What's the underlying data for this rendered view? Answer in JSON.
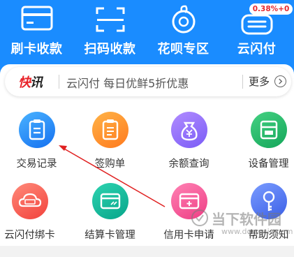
{
  "colors": {
    "header_blue": "#1a8cff",
    "news_tag_red": "#e8232a",
    "annotation_arrow": "#e02020"
  },
  "top_nav": {
    "items": [
      {
        "label": "刷卡收款",
        "icon": "card-icon"
      },
      {
        "label": "扫码收款",
        "icon": "scan-icon"
      },
      {
        "label": "花呗专区",
        "icon": "huabei-icon"
      },
      {
        "label": "云闪付",
        "icon": "quickpass-icon"
      }
    ],
    "rate_badge": "0.38%+0"
  },
  "news": {
    "tag_part1": "快",
    "tag_part2": "讯",
    "text": "云闪付 每日优鲜5折优惠",
    "more_label": "更多"
  },
  "functions": [
    {
      "label": "交易记录",
      "icon": "transaction-record-icon",
      "color": "blue"
    },
    {
      "label": "签购单",
      "icon": "receipt-icon",
      "color": "orange"
    },
    {
      "label": "余额查询",
      "icon": "money-bag-icon",
      "color": "purple"
    },
    {
      "label": "设备管理",
      "icon": "device-icon",
      "color": "green"
    },
    {
      "label": "云闪付绑卡",
      "icon": "cloud-card-icon",
      "color": "red"
    },
    {
      "label": "结算卡管理",
      "icon": "settlement-card-icon",
      "color": "teal"
    },
    {
      "label": "信用卡申请",
      "icon": "credit-card-apply-icon",
      "color": "pink"
    },
    {
      "label": "帮助须知",
      "icon": "key-icon",
      "color": "navy"
    }
  ],
  "watermark": {
    "text": "当下软件园",
    "url": "www.downxia.com"
  }
}
